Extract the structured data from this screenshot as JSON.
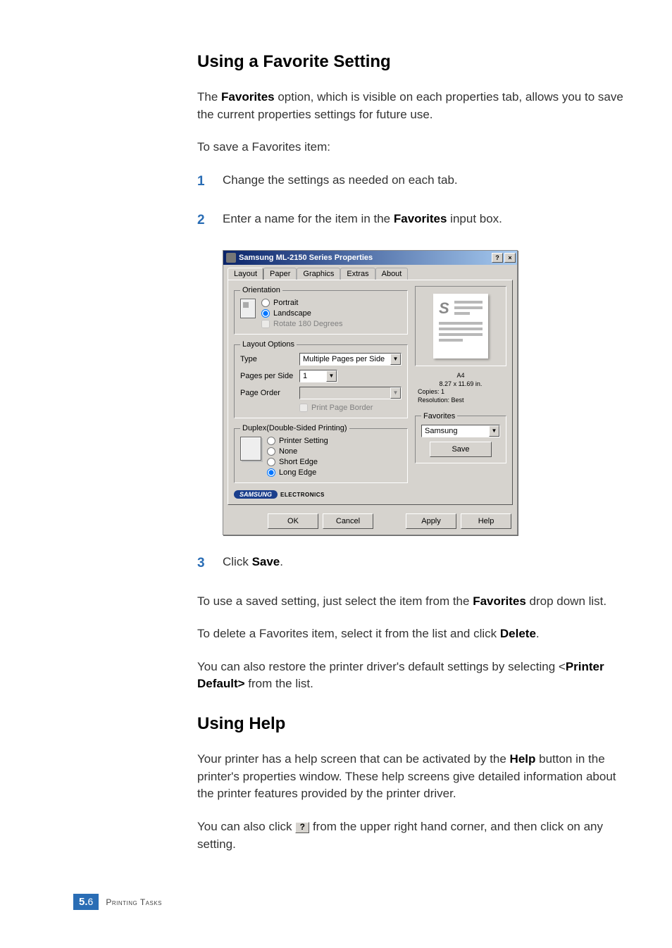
{
  "heading1": "Using a Favorite Setting",
  "p1_a": "The ",
  "p1_b": "Favorites",
  "p1_c": " option, which is visible on each properties tab, allows you to save the current properties settings for future use.",
  "p2": "To save a Favorites item:",
  "steps": {
    "s1": {
      "num": "1",
      "text": "Change the settings as needed on each tab."
    },
    "s2": {
      "num": "2",
      "text_a": "Enter a name for the item in the ",
      "text_b": "Favorites",
      "text_c": " input box."
    },
    "s3": {
      "num": "3",
      "text_a": "Click ",
      "text_b": "Save",
      "text_c": "."
    }
  },
  "p3_a": "To use a saved setting, just select the item from the ",
  "p3_b": "Favorites",
  "p3_c": " drop down list.",
  "p4_a": "To delete a Favorites item, select it from the list and click ",
  "p4_b": "Delete",
  "p4_c": ".",
  "p5_a": "You can also restore the printer driver's default settings by selecting <",
  "p5_b": "Printer Default>",
  "p5_c": " from the list.",
  "heading2": "Using Help",
  "p6_a": "Your printer has a help screen that can be activated by the ",
  "p6_b": "Help",
  "p6_c": " button in the printer's properties window. These help screens give detailed information about the printer features provided by the printer driver.",
  "p7_a": "You can also click ",
  "p7_b": " from the upper right hand corner, and then click on any setting.",
  "help_glyph": "?",
  "dialog": {
    "title": "Samsung ML-2150 Series Properties",
    "help_btn": "?",
    "close_btn": "×",
    "tabs": [
      "Layout",
      "Paper",
      "Graphics",
      "Extras",
      "About"
    ],
    "orientation": {
      "legend": "Orientation",
      "portrait": "Portrait",
      "landscape": "Landscape",
      "rotate": "Rotate 180 Degrees"
    },
    "layout_options": {
      "legend": "Layout Options",
      "type_label": "Type",
      "type_value": "Multiple Pages per Side",
      "pps_label": "Pages per Side",
      "pps_value": "1",
      "order_label": "Page Order",
      "order_value": "",
      "border": "Print Page Border"
    },
    "duplex": {
      "legend": "Duplex(Double-Sided Printing)",
      "opt1": "Printer Setting",
      "opt2": "None",
      "opt3": "Short Edge",
      "opt4": "Long Edge"
    },
    "preview": {
      "s": "S",
      "size": "A4",
      "dims": "8.27 x 11.69 in.",
      "copies": "Copies: 1",
      "resolution": "Resolution: Best"
    },
    "favorites": {
      "legend": "Favorites",
      "value": "Samsung",
      "save": "Save"
    },
    "brand": "SAMSUNG",
    "brand_sub": "ELECTRONICS",
    "buttons": {
      "ok": "OK",
      "cancel": "Cancel",
      "apply": "Apply",
      "help": "Help"
    }
  },
  "footer": {
    "chapter": "5.",
    "page": "6",
    "label": "Printing Tasks"
  }
}
